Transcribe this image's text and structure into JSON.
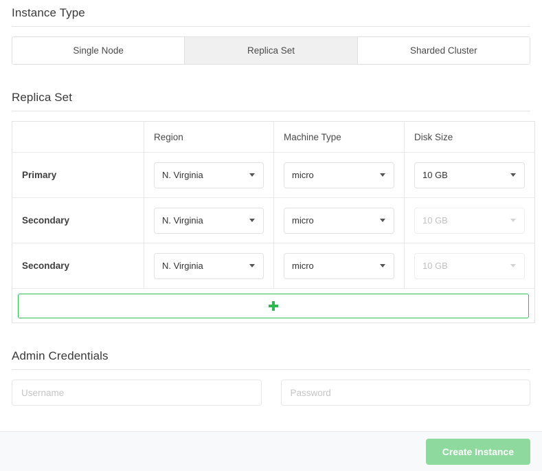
{
  "instance_type": {
    "heading": "Instance Type",
    "tabs": [
      {
        "label": "Single Node",
        "active": false
      },
      {
        "label": "Replica Set",
        "active": true
      },
      {
        "label": "Sharded Cluster",
        "active": false
      }
    ]
  },
  "replica_set": {
    "heading": "Replica Set",
    "columns": [
      "",
      "Region",
      "Machine Type",
      "Disk Size"
    ],
    "rows": [
      {
        "role": "Primary",
        "region": "N. Virginia",
        "machine_type": "micro",
        "disk_size": "10 GB",
        "disk_disabled": false
      },
      {
        "role": "Secondary",
        "region": "N. Virginia",
        "machine_type": "micro",
        "disk_size": "10 GB",
        "disk_disabled": true
      },
      {
        "role": "Secondary",
        "region": "N. Virginia",
        "machine_type": "micro",
        "disk_size": "10 GB",
        "disk_disabled": true
      }
    ],
    "add_row_icon": "plus-icon"
  },
  "admin_credentials": {
    "heading": "Admin Credentials",
    "username": {
      "value": "",
      "placeholder": "Username"
    },
    "password": {
      "value": "",
      "placeholder": "Password"
    }
  },
  "footer": {
    "create_label": "Create Instance"
  },
  "colors": {
    "accent_green": "#2fb84f",
    "button_green": "#8ed99e",
    "active_tab_bg": "#f0f0f0",
    "footer_bg": "#f8f9fa"
  }
}
